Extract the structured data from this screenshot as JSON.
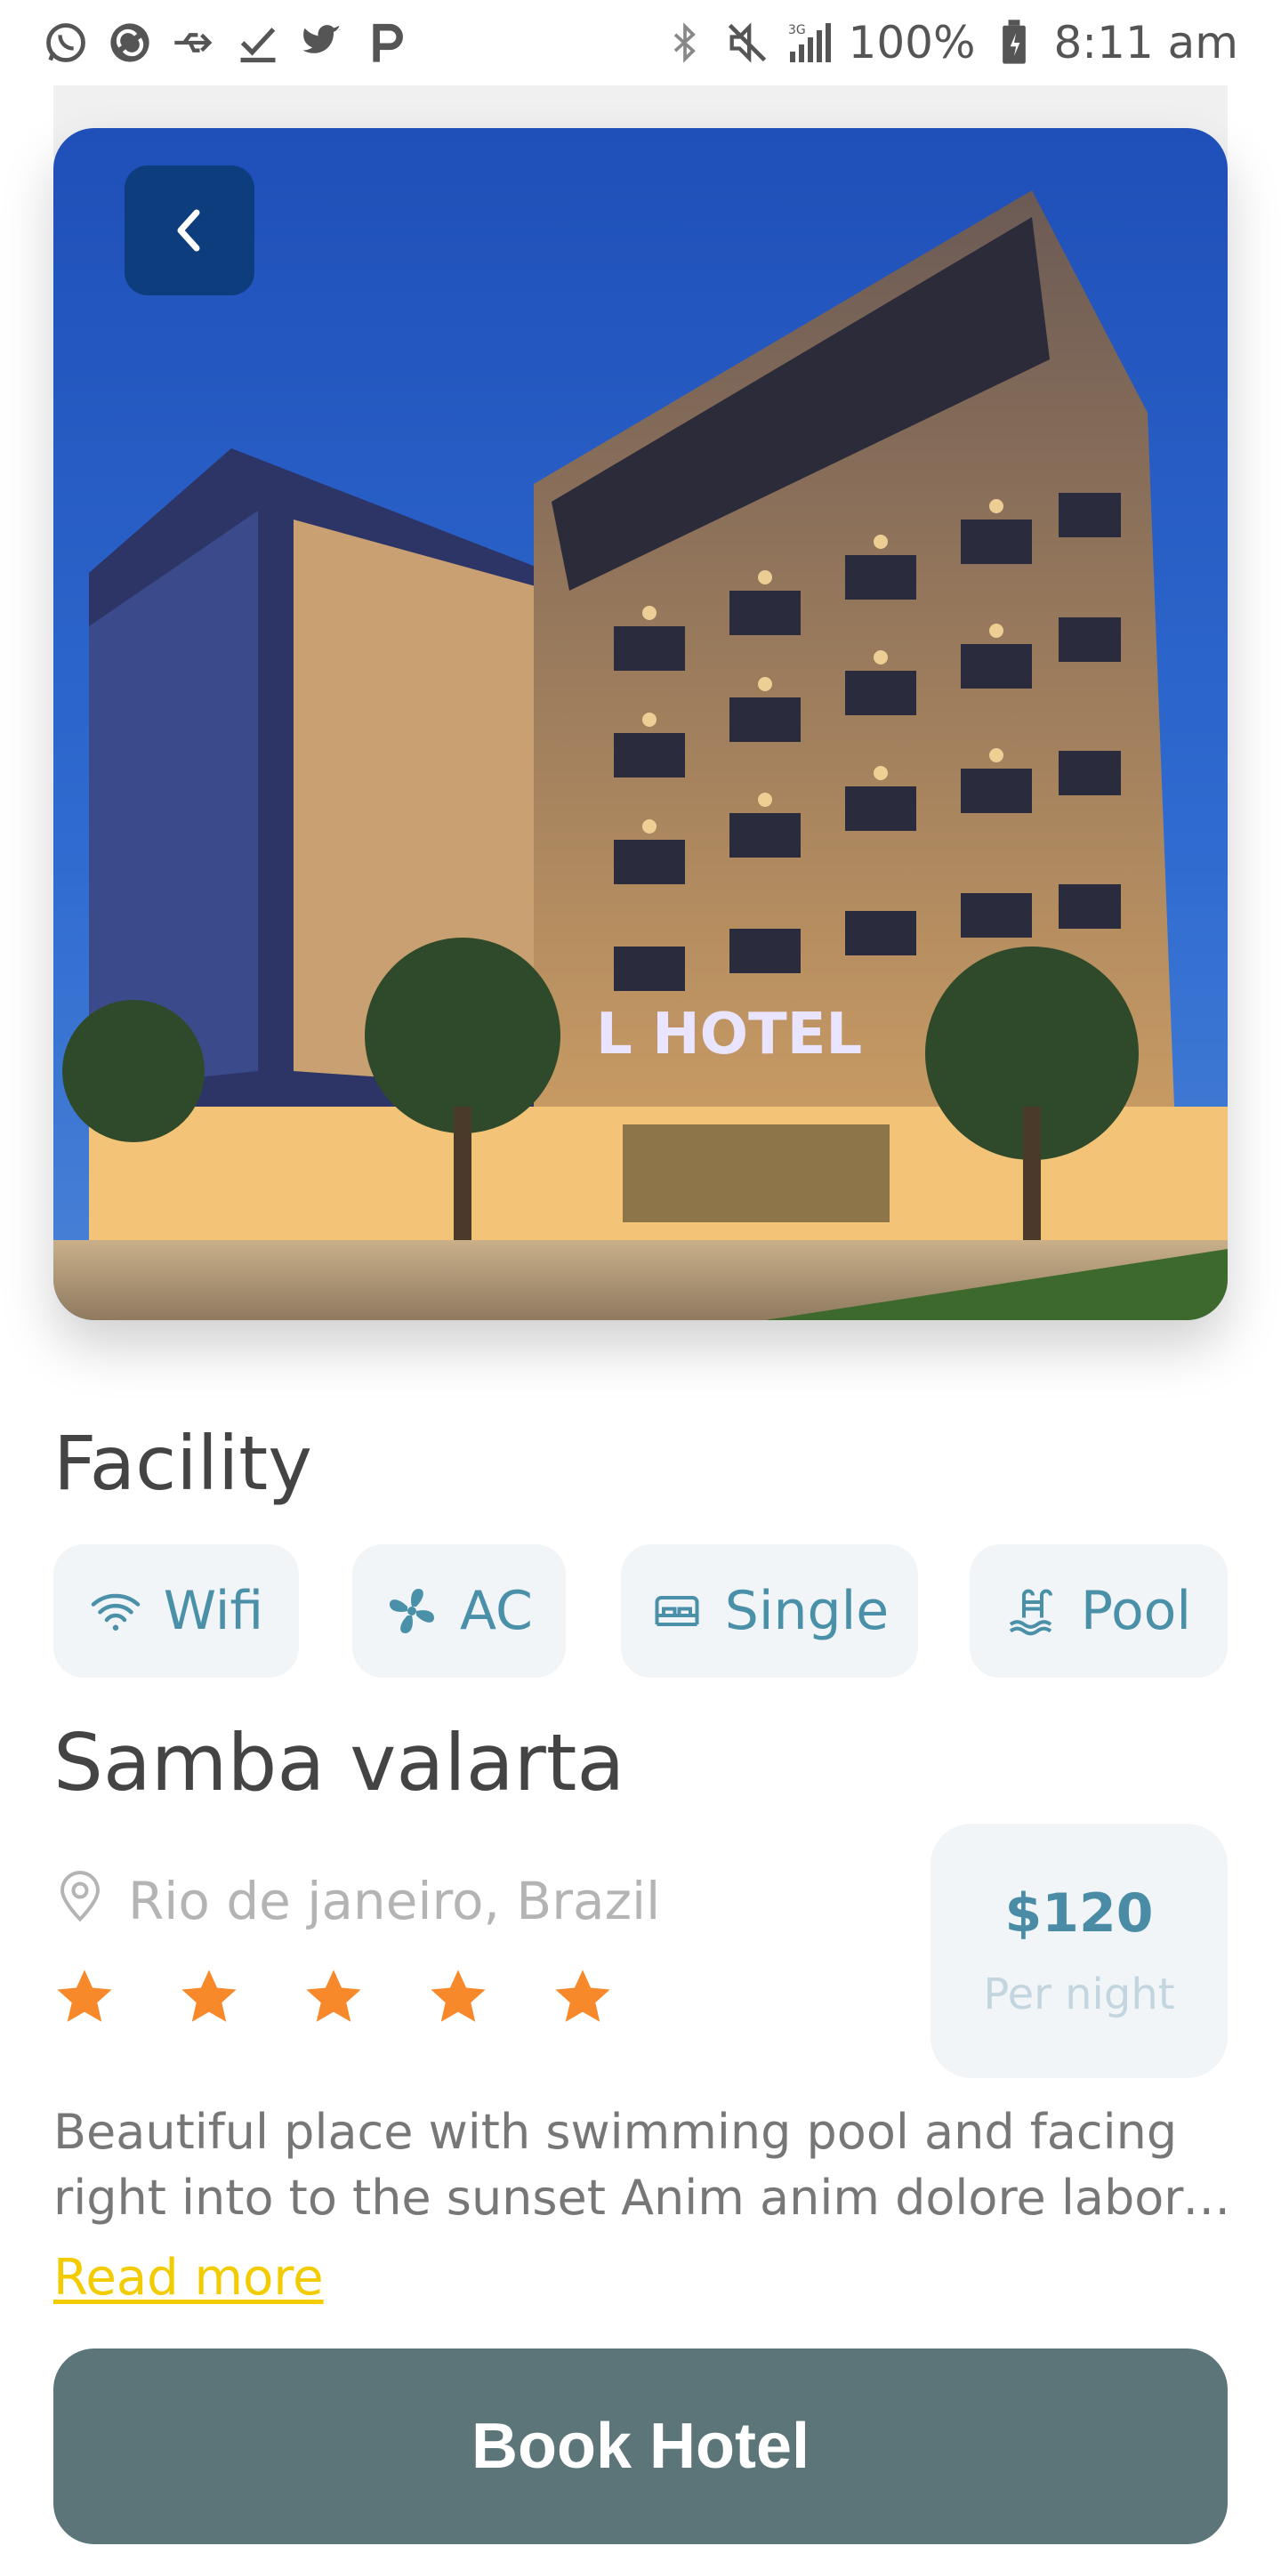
{
  "status_bar": {
    "left_icons": [
      "whatsapp-icon",
      "sync-icon",
      "usb-icon",
      "download-done-icon",
      "twitter-icon",
      "p-app-icon"
    ],
    "right_icons": [
      "bluetooth-icon",
      "mute-icon",
      "signal-3g-icon",
      "battery-icon"
    ],
    "battery": "100%",
    "time": "8:11 am"
  },
  "hero": {
    "image": "hotel-building-photo",
    "sign_text": "L HOTEL"
  },
  "facility": {
    "title": "Facility",
    "chips": [
      {
        "label": "Wifi",
        "icon": "wifi-icon"
      },
      {
        "label": "AC",
        "icon": "fan-icon"
      },
      {
        "label": "Single",
        "icon": "bed-icon"
      },
      {
        "label": "Pool",
        "icon": "pool-icon"
      }
    ]
  },
  "hotel": {
    "name": "Samba valarta",
    "location": "Rio de janeiro, Brazil",
    "rating": 5,
    "rating_max": 5,
    "price": "$120",
    "price_unit": "Per night",
    "description": "Beautiful place with swimming pool and facing right into to the sunset Anim anim dolore labore et cillum do officia dolore",
    "read_more": "Read more"
  },
  "cta": {
    "label": "Book Hotel"
  },
  "colors": {
    "accent": "#4a90a8",
    "star": "#f7892a",
    "cta_bg": "#5b7579",
    "read_more": "#f2cc00",
    "back_btn": "#0d3d7d"
  }
}
